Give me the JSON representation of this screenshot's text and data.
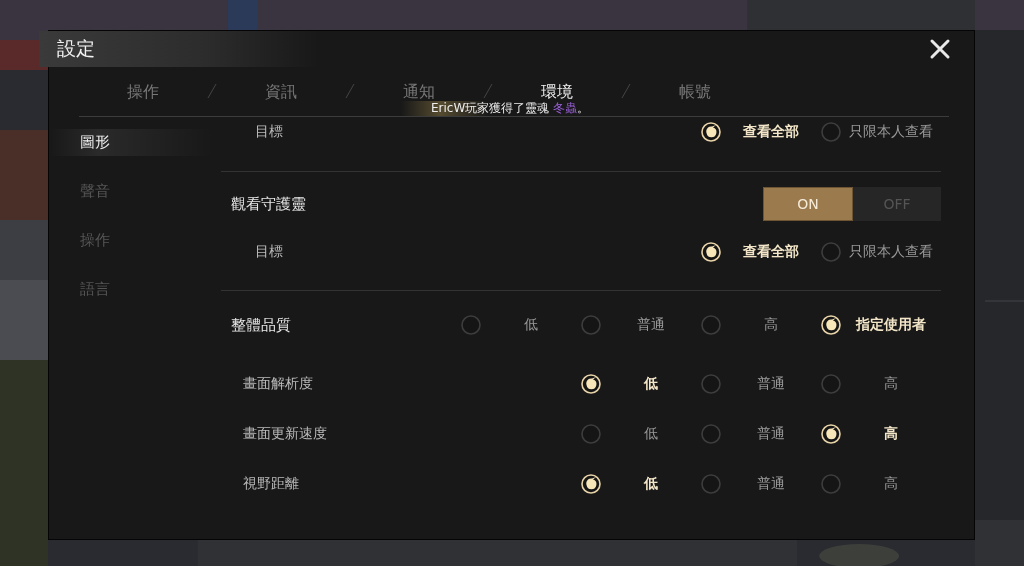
{
  "window": {
    "title": "設定"
  },
  "tabs": [
    {
      "label": "操作",
      "selected": false
    },
    {
      "label": "資訊",
      "selected": false
    },
    {
      "label": "通知",
      "selected": false
    },
    {
      "label": "環境",
      "selected": true
    },
    {
      "label": "帳號",
      "selected": false
    }
  ],
  "toast": {
    "text": "EricW玩家獲得了靈魂 ",
    "item": "冬蟲",
    "end": "。"
  },
  "sidebar": {
    "items": [
      {
        "label": "圖形",
        "selected": true
      },
      {
        "label": "聲音",
        "selected": false
      },
      {
        "label": "操作",
        "selected": false
      },
      {
        "label": "語言",
        "selected": false
      }
    ]
  },
  "groups": [
    {
      "children": [
        {
          "label": "目標",
          "kind": "radio",
          "options": [
            {
              "label": "查看全部",
              "selected": true
            },
            {
              "label": "只限本人查看",
              "selected": false
            }
          ]
        }
      ]
    },
    {
      "label": "觀看守護靈",
      "kind": "toggle",
      "options": [
        {
          "label": "ON",
          "selected": true
        },
        {
          "label": "OFF",
          "selected": false
        }
      ],
      "children": [
        {
          "label": "目標",
          "kind": "radio",
          "options": [
            {
              "label": "查看全部",
              "selected": true
            },
            {
              "label": "只限本人查看",
              "selected": false
            }
          ]
        }
      ]
    },
    {
      "label": "整體品質",
      "kind": "radio",
      "options": [
        {
          "label": "低",
          "selected": false
        },
        {
          "label": "普通",
          "selected": false
        },
        {
          "label": "高",
          "selected": false
        },
        {
          "label": "指定使用者",
          "selected": true
        }
      ],
      "children": [
        {
          "label": "畫面解析度",
          "kind": "radio",
          "options": [
            {
              "label": "低",
              "selected": true
            },
            {
              "label": "普通",
              "selected": false
            },
            {
              "label": "高",
              "selected": false
            }
          ]
        },
        {
          "label": "畫面更新速度",
          "kind": "radio",
          "options": [
            {
              "label": "低",
              "selected": false
            },
            {
              "label": "普通",
              "selected": false
            },
            {
              "label": "高",
              "selected": true
            }
          ]
        },
        {
          "label": "視野距離",
          "kind": "radio",
          "options": [
            {
              "label": "低",
              "selected": true
            },
            {
              "label": "普通",
              "selected": false
            },
            {
              "label": "高",
              "selected": false
            }
          ]
        }
      ]
    }
  ]
}
